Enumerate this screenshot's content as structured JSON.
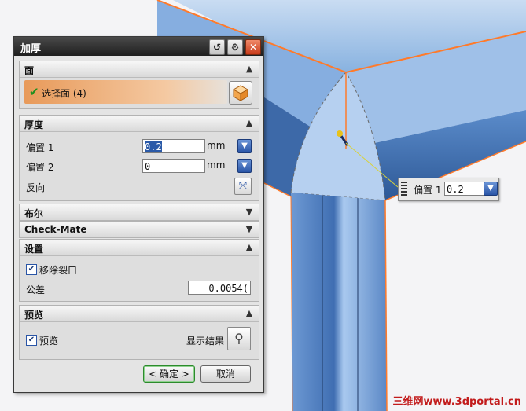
{
  "dialog": {
    "title": "加厚",
    "title_buttons": [
      "reset-icon",
      "gear-icon",
      "close-icon"
    ]
  },
  "face_section": {
    "header": "面",
    "select_face_label": "选择面 (4)"
  },
  "thickness_section": {
    "header": "厚度",
    "offset1": {
      "label": "偏置 1",
      "value": "0.2",
      "unit": "mm"
    },
    "offset2": {
      "label": "偏置 2",
      "value": "0",
      "unit": "mm"
    },
    "reverse_label": "反向"
  },
  "collapsed_sections": {
    "boolean": "布尔",
    "checkmate": "Check-Mate"
  },
  "settings_section": {
    "header": "设置",
    "remove_cracks_label": "移除裂口",
    "remove_cracks_checked": true,
    "tolerance_label": "公差",
    "tolerance_value": "0.0054("
  },
  "preview_section": {
    "header": "预览",
    "preview_label": "预览",
    "preview_checked": true,
    "show_result_label": "显示结果"
  },
  "buttons": {
    "ok": "< 确定 >",
    "cancel": "取消"
  },
  "floating_label": {
    "label": "偏置 1",
    "value": "0.2"
  },
  "watermark": "三维网www.3dportal.cn",
  "colors": {
    "model_blue": "#6f9fd8",
    "edge_orange": "#ff7a2a",
    "selection_highlight": "#e89a5a"
  }
}
